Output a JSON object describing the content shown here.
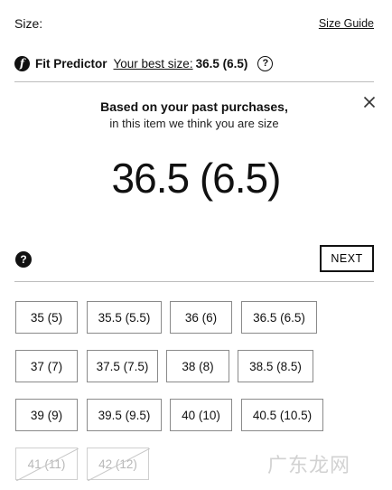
{
  "header": {
    "size_label": "Size:",
    "size_guide": "Size Guide"
  },
  "fit_predictor": {
    "icon": "fit-predictor-logo-icon",
    "title": "Fit Predictor",
    "best_size_label": "Your best size:",
    "best_size_value": "36.5 (6.5)",
    "help_icon": "question-icon"
  },
  "panel": {
    "line1": "Based on your past purchases,",
    "line2": "in this item we think you are size",
    "size": "36.5 (6.5)",
    "close_icon": "close-icon",
    "help_icon": "question-icon",
    "next": "NEXT"
  },
  "sizes": [
    {
      "label": "35 (5)",
      "available": true
    },
    {
      "label": "35.5 (5.5)",
      "available": true
    },
    {
      "label": "36 (6)",
      "available": true
    },
    {
      "label": "36.5 (6.5)",
      "available": true
    },
    {
      "label": "37 (7)",
      "available": true
    },
    {
      "label": "37.5 (7.5)",
      "available": true
    },
    {
      "label": "38 (8)",
      "available": true
    },
    {
      "label": "38.5 (8.5)",
      "available": true
    },
    {
      "label": "39 (9)",
      "available": true
    },
    {
      "label": "39.5 (9.5)",
      "available": true
    },
    {
      "label": "40 (10)",
      "available": true
    },
    {
      "label": "40.5 (10.5)",
      "available": true
    },
    {
      "label": "41 (11)",
      "available": false
    },
    {
      "label": "42 (12)",
      "available": false
    }
  ],
  "watermark": "广东龙网"
}
